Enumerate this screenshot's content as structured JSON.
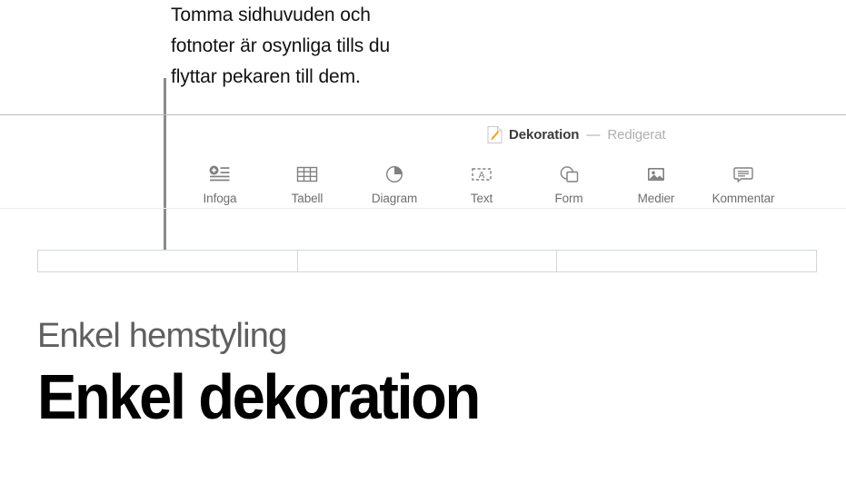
{
  "callout": {
    "text": "Tomma sidhuvuden och\nfotnoter är osynliga tills du\nflyttar pekaren till dem.",
    "leader_line_color": "#8a8a8a"
  },
  "titlebar": {
    "document_icon": "pages-document-icon",
    "document_name": "Dekoration",
    "separator": "—",
    "status": "Redigerat",
    "title_color": "#3a3a3a",
    "status_color": "#b0b0b0"
  },
  "toolbar": {
    "items": [
      {
        "label": "Infoga",
        "icon": "insert-icon"
      },
      {
        "label": "Tabell",
        "icon": "table-icon"
      },
      {
        "label": "Diagram",
        "icon": "chart-icon"
      },
      {
        "label": "Text",
        "icon": "text-box-icon"
      },
      {
        "label": "Form",
        "icon": "shape-icon"
      },
      {
        "label": "Medier",
        "icon": "media-image-icon"
      },
      {
        "label": "Kommentar",
        "icon": "comment-bubble-icon"
      }
    ],
    "label_color": "#6e6e6e",
    "icon_color": "#808080"
  },
  "header_fields": {
    "border_color": "#d2d6dd",
    "cells": [
      "",
      "",
      ""
    ]
  },
  "document": {
    "subtitle": "Enkel hemstyling",
    "title": "Enkel dekoration",
    "subtitle_color": "#5f5f5f",
    "title_color": "#000000"
  }
}
